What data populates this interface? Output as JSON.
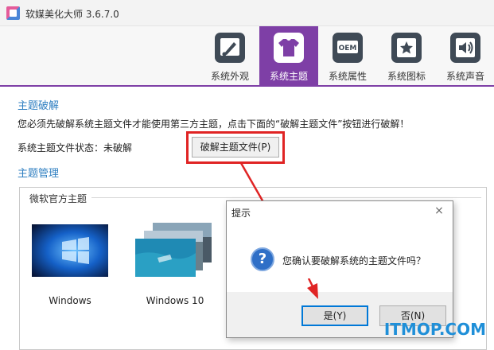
{
  "window": {
    "title": "软媒美化大师 3.6.7.0"
  },
  "toolbar": {
    "items": [
      {
        "label": "系统外观",
        "icon": "brush-icon",
        "active": false
      },
      {
        "label": "系统主题",
        "icon": "tshirt-icon",
        "active": true
      },
      {
        "label": "系统属性",
        "icon": "oem-icon",
        "active": false
      },
      {
        "label": "系统图标",
        "icon": "star-icon",
        "active": false
      },
      {
        "label": "系统声音",
        "icon": "speaker-icon",
        "active": false
      }
    ],
    "oem_text": "OEM"
  },
  "crack_section": {
    "title": "主题破解",
    "info": "您必须先破解系统主题文件才能使用第三方主题，点击下面的“破解主题文件”按钮进行破解！",
    "status_text": "系统主题文件状态：未破解",
    "button_label": "破解主题文件(P)"
  },
  "manage_section": {
    "title": "主题管理",
    "group_title": "微软官方主题",
    "themes": [
      {
        "name": "Windows"
      },
      {
        "name": "Windows 10"
      }
    ]
  },
  "dialog": {
    "title": "提示",
    "close": "×",
    "icon": "question-icon",
    "message": "您确认要破解系统的主题文件吗？",
    "yes_label": "是(Y)",
    "no_label": "否(N)"
  },
  "watermark": "ITMOP.COM",
  "colors": {
    "accent": "#7e3fa6",
    "link_blue": "#2f7fc1",
    "highlight_red": "#e02424",
    "dialog_blue": "#0078d7"
  }
}
